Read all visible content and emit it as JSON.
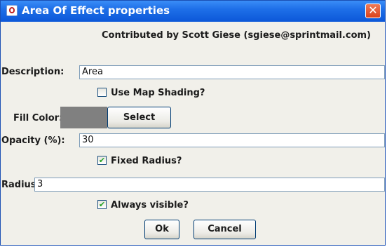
{
  "window": {
    "title": "Area Of Effect properties",
    "close_glyph": "✕",
    "icon": "java-cup-icon"
  },
  "credit": "Contributed by Scott Giese (sgiese@sprintmail.com)",
  "description": {
    "label": "Description:",
    "value": "Area"
  },
  "map_shading": {
    "label": "Use Map Shading?",
    "checked": false
  },
  "fill_color": {
    "label": "Fill Color:",
    "swatch_color": "#808080",
    "select_label": "Select"
  },
  "opacity": {
    "label": "Opacity (%):",
    "value": "30"
  },
  "fixed_radius": {
    "label": "Fixed Radius?",
    "checked": true
  },
  "radius": {
    "label": "Radius:",
    "value": "3"
  },
  "always_visible": {
    "label": "Always visible?",
    "checked": true
  },
  "buttons": {
    "ok": "Ok",
    "cancel": "Cancel"
  },
  "check_glyph": "✔",
  "colors": {
    "titlebar": "#0c57d8",
    "panel": "#f1f0ea",
    "field_border": "#7f9db9",
    "close": "#d9411b"
  }
}
